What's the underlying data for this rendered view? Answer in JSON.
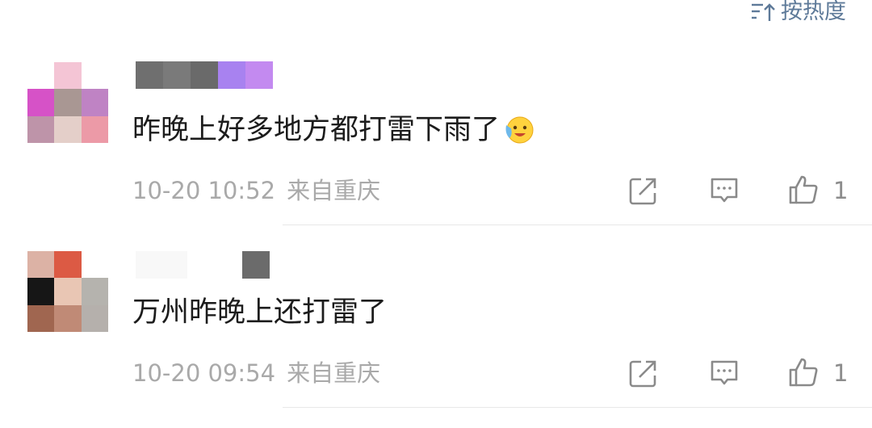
{
  "sort": {
    "label": "按热度",
    "icon": "sort-icon"
  },
  "comments": [
    {
      "avatar_colors": [
        "#ffffff",
        "#f4c5d5",
        "#ffffff",
        "#d652c7",
        "#a99793",
        "#bf83c4",
        "#be94a9",
        "#e4cfc9",
        "#ec9aa7"
      ],
      "name_colors": [
        "#6f6f6f",
        "#7a7a7a",
        "#6a6a6a",
        "#a882f0",
        "#c38af0"
      ],
      "text": "昨晚上好多地方都打雷下雨了",
      "emoji": "crying-laughing-emoji",
      "date": "10-20 10:52",
      "location": "来自重庆",
      "likes": "1"
    },
    {
      "avatar_colors": [
        "#dcb2a5",
        "#dc5a44",
        "#ffffff",
        "#161616",
        "#e9c6b4",
        "#b5b3ae",
        "#a06650",
        "#c08a76",
        "#b5b0ac"
      ],
      "name_colors": [
        "#f8f8f8",
        "#ffffff",
        "#ffffff",
        "#6b6b6b"
      ],
      "text": "万州昨晚上还打雷了",
      "date": "10-20 09:54",
      "location": "来自重庆",
      "likes": "1"
    }
  ],
  "colors": {
    "link_blue": "#5e7a99",
    "meta_gray": "#a9a9a9",
    "icon_gray": "#8a8a8a"
  }
}
